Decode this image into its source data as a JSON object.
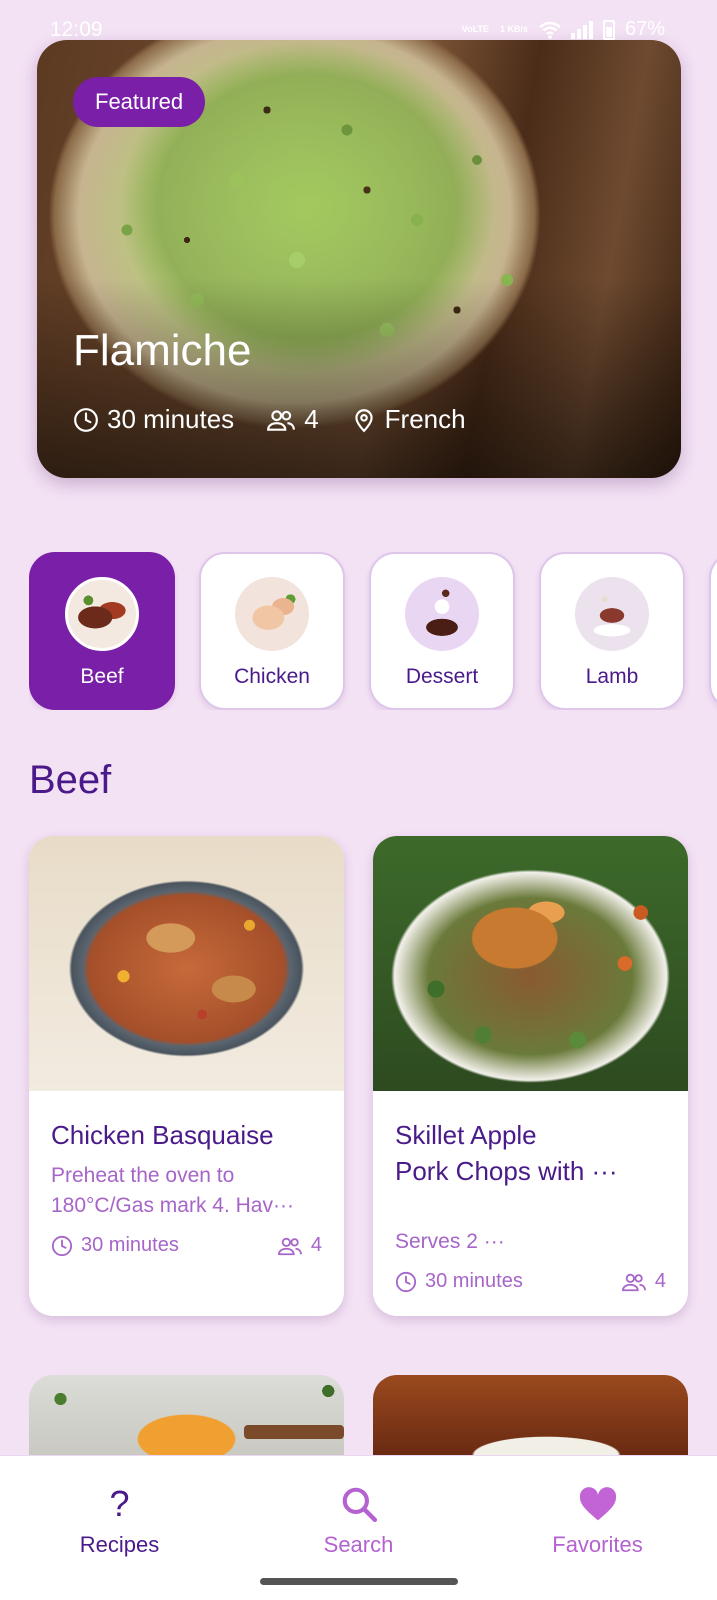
{
  "status_bar": {
    "time": "12:09",
    "net_label": "VoLTE",
    "speed": "1 KB/s",
    "battery": "67%"
  },
  "featured": {
    "badge": "Featured",
    "title": "Flamiche",
    "time": "30 minutes",
    "servings": "4",
    "cuisine": "French"
  },
  "categories": [
    {
      "label": "Beef",
      "active": true
    },
    {
      "label": "Chicken",
      "active": false
    },
    {
      "label": "Dessert",
      "active": false
    },
    {
      "label": "Lamb",
      "active": false
    }
  ],
  "section": {
    "title": "Beef"
  },
  "recipes": [
    {
      "title": "Chicken Basquaise",
      "desc_line1": "Preheat the oven to",
      "desc_line2": "180°C/Gas mark 4. Hav···",
      "time": "30 minutes",
      "servings": "4"
    },
    {
      "title_line1": "Skillet Apple",
      "title_line2": "Pork Chops with ···",
      "desc": "Serves 2 ···",
      "time": "30 minutes",
      "servings": "4"
    }
  ],
  "nav": {
    "recipes": {
      "label": "Recipes",
      "icon": "?"
    },
    "search": {
      "label": "Search"
    },
    "favorites": {
      "label": "Favorites"
    }
  },
  "colors": {
    "primary": "#7a1fa8",
    "background": "#f3e1f4",
    "text_dark": "#4a1a8a",
    "text_muted": "#a765c8"
  }
}
